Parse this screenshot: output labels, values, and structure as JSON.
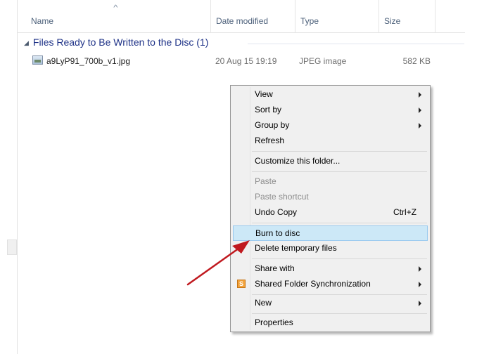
{
  "columns": {
    "name": "Name",
    "date_modified": "Date modified",
    "type": "Type",
    "size": "Size"
  },
  "group": {
    "title": "Files Ready to Be Written to the Disc (1)"
  },
  "file": {
    "name": "a9LyP91_700b_v1.jpg",
    "date": "20 Aug 15 19:19",
    "type": "JPEG image",
    "size": "582 KB"
  },
  "context_menu": {
    "items": {
      "view": "View",
      "sort_by": "Sort by",
      "group_by": "Group by",
      "refresh": "Refresh",
      "customize": "Customize this folder...",
      "paste": "Paste",
      "paste_shortcut": "Paste shortcut",
      "undo_copy": "Undo Copy",
      "undo_copy_shortcut": "Ctrl+Z",
      "burn_to_disc": "Burn to disc",
      "delete_temp": "Delete temporary files",
      "share_with": "Share with",
      "shared_folder_sync": "Shared Folder Synchronization",
      "new": "New",
      "properties": "Properties"
    },
    "highlighted_item": "Burn to disc"
  },
  "annotation": {
    "arrow_color": "#c0191f"
  }
}
